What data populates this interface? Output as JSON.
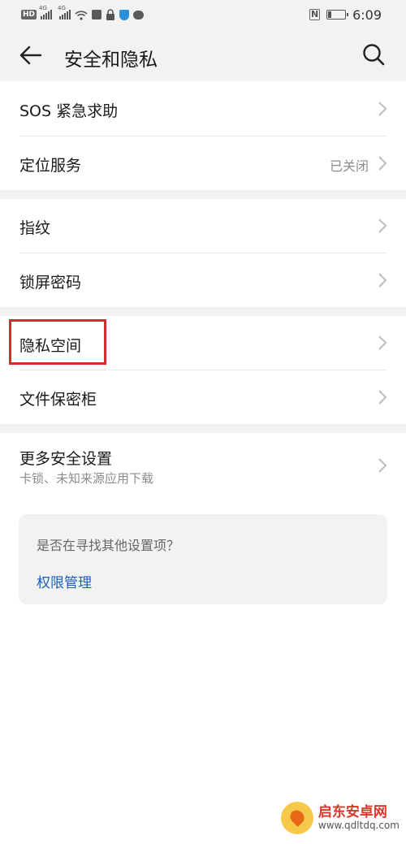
{
  "status_bar": {
    "hd": "HD",
    "net1": "4G",
    "net2": "4G",
    "nfc": "N",
    "battery_level": 0.2,
    "time": "6:09"
  },
  "header": {
    "title": "安全和隐私"
  },
  "groups": [
    {
      "items": [
        {
          "label": "SOS 紧急求助"
        },
        {
          "label": "定位服务",
          "value": "已关闭"
        }
      ]
    },
    {
      "items": [
        {
          "label": "指纹"
        },
        {
          "label": "锁屏密码"
        }
      ]
    },
    {
      "items": [
        {
          "label": "隐私空间",
          "highlighted": true
        },
        {
          "label": "文件保密柜"
        }
      ]
    },
    {
      "items": [
        {
          "label": "更多安全设置",
          "subtitle": "卡锁、未知来源应用下载"
        }
      ]
    }
  ],
  "suggestion": {
    "question": "是否在寻找其他设置项？",
    "link": "权限管理"
  },
  "watermark": {
    "name": "启东安卓网",
    "url": "www.qdltdq.com"
  },
  "colors": {
    "accent_link": "#1b5fbf",
    "highlight_box": "#d22c2c",
    "background_gray": "#f2f2f2"
  }
}
